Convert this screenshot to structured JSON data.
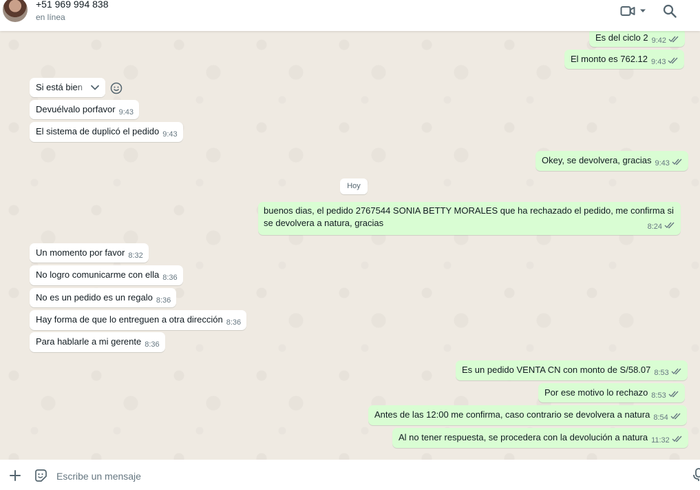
{
  "header": {
    "contact_name": "+51 969 994 838",
    "contact_status": "en línea",
    "icons": [
      "avatar",
      "video-call-icon",
      "chevron-down-icon",
      "search-icon"
    ]
  },
  "date_divider": "Hoy",
  "messages": [
    {
      "dir": "out",
      "text": "Es del ciclo 2",
      "time": "9:42"
    },
    {
      "dir": "out",
      "text": "El monto es 762.12",
      "time": "9:43"
    },
    {
      "dir": "in",
      "text": "Si está bien",
      "time": ""
    },
    {
      "dir": "in",
      "text": "Devuélvalo porfavor",
      "time": "9:43"
    },
    {
      "dir": "in",
      "text": "El sistema de duplicó el pedido",
      "time": "9:43"
    },
    {
      "dir": "out",
      "text": "Okey, se devolvera, gracias",
      "time": "9:43"
    },
    {
      "dir": "out",
      "text": "buenos dias, el pedido 2767544 SONIA BETTY MORALES que ha rechazado el pedido, me confirma si se devolvera a natura, gracias",
      "time": "8:24"
    },
    {
      "dir": "in",
      "text": "Un momento por favor",
      "time": "8:32"
    },
    {
      "dir": "in",
      "text": "No logro comunicarme con ella",
      "time": "8:36"
    },
    {
      "dir": "in",
      "text": "No es un pedido es un regalo",
      "time": "8:36"
    },
    {
      "dir": "in",
      "text": "Hay forma de que lo entreguen a otra dirección",
      "time": "8:36"
    },
    {
      "dir": "in",
      "text": "Para hablarle a mi gerente",
      "time": "8:36"
    },
    {
      "dir": "out",
      "text": "Es un pedido VENTA CN con monto de S/58.07",
      "time": "8:53"
    },
    {
      "dir": "out",
      "text": "Por ese motivo lo rechazo",
      "time": "8:53"
    },
    {
      "dir": "out",
      "text": "Antes de las 12:00 me confirma, caso contrario se devolvera a natura",
      "time": "8:54"
    },
    {
      "dir": "out",
      "text": "Al no tener respuesta, se procedera con la devolución a natura",
      "time": "11:32"
    }
  ],
  "composer": {
    "placeholder": "Escribe un mensaje",
    "icons": [
      "plus-icon",
      "sticker-icon",
      "microphone-icon"
    ]
  },
  "colors": {
    "chat_background": "#efeae2",
    "outgoing_bubble": "#d9fdd3",
    "incoming_bubble": "#ffffff",
    "read_ticks": "#667781"
  }
}
